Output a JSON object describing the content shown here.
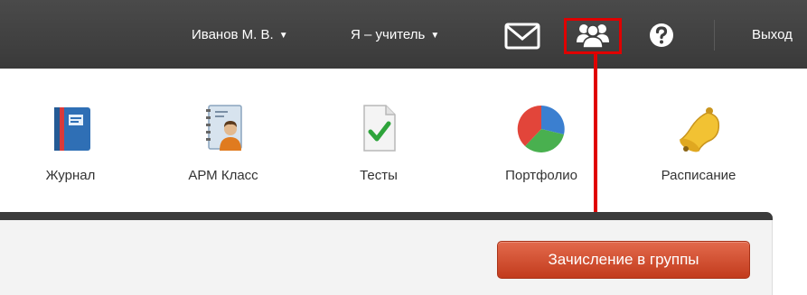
{
  "topbar": {
    "user_name": "Иванов М. В.",
    "role": "Я – учитель",
    "logout": "Выход",
    "icons": [
      "mail-icon",
      "groups-icon",
      "help-icon"
    ]
  },
  "apps": [
    {
      "label": "Журнал",
      "icon": "journal-icon"
    },
    {
      "label": "АРМ Класс",
      "icon": "arm-class-icon"
    },
    {
      "label": "Тесты",
      "icon": "tests-icon"
    },
    {
      "label": "Портфолио",
      "icon": "portfolio-icon"
    },
    {
      "label": "Расписание",
      "icon": "schedule-bell-icon"
    }
  ],
  "panel": {
    "enroll_button": "Зачисление в группы"
  },
  "colors": {
    "topbar_bg": "#3d3d3d",
    "highlight": "#e00000",
    "button": "#d44a2a"
  }
}
